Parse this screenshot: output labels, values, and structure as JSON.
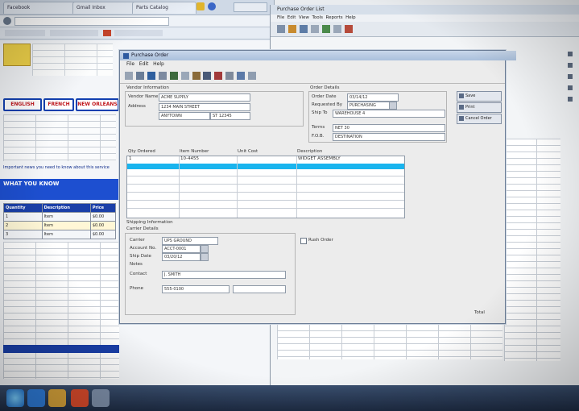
{
  "browser": {
    "tabs": [
      "Facebook",
      "Gmail Inbox",
      "Parts Catalog"
    ],
    "nav": {
      "site_buttons": [
        "ENGLISH",
        "FRENCH",
        "NEW ORLEANS"
      ]
    },
    "notice": "Important news you need to know about this service",
    "section_title": "WHAT YOU KNOW",
    "table": {
      "headers": [
        "Quantity",
        "Description",
        "Price"
      ],
      "rows": [
        [
          "1",
          "Item",
          "$0.00"
        ],
        [
          "2",
          "Item",
          "$0.00"
        ],
        [
          "3",
          "Item",
          "$0.00"
        ]
      ]
    }
  },
  "right_window": {
    "title": "Purchase Order List",
    "menu": [
      "File",
      "Edit",
      "View",
      "Tools",
      "Reports",
      "Help"
    ]
  },
  "dialog": {
    "title": "Purchase Order",
    "menu": [
      "File",
      "Edit",
      "Help"
    ],
    "vendor_section": "Vendor Information",
    "order_section": "Order Details",
    "vendor": {
      "label_name": "Vendor Name",
      "label_address": "Address",
      "name_value": "ACME SUPPLY",
      "address_line1": "1234 MAIN STREET",
      "address_line2": "ANYTOWN",
      "address_state": "ST 12345"
    },
    "order": {
      "label_date": "Order Date",
      "label_req": "Requested By",
      "label_ship": "Ship To",
      "label_terms": "Terms",
      "label_fob": "F.O.B.",
      "date_value": "03/14/12",
      "req_value": "PURCHASING",
      "ship_value": "WAREHOUSE 4",
      "terms_value": "NET 30",
      "fob_value": "DESTINATION"
    },
    "side_buttons": [
      "Save",
      "Print",
      "Cancel Order"
    ],
    "lines": {
      "columns": [
        "Qty Ordered",
        "Item Number",
        "Unit Cost",
        "Description"
      ],
      "rows": [
        [
          "1",
          "10-4455",
          "",
          "WIDGET ASSEMBLY"
        ],
        [
          "",
          "",
          "",
          ""
        ],
        [
          "",
          "",
          "",
          ""
        ],
        [
          "",
          "",
          "",
          ""
        ],
        [
          "",
          "",
          "",
          ""
        ]
      ]
    },
    "bottom": {
      "section": "Shipping Information",
      "sub": "Carrier Details",
      "label_carrier": "Carrier",
      "label_account": "Account No.",
      "label_ship_date": "Ship Date",
      "label_notes": "Notes",
      "label_contact": "Contact",
      "label_phone": "Phone",
      "carrier_value": "UPS GROUND",
      "account_value": "ACCT-0001",
      "ship_date_value": "03/20/12",
      "contact_value": "J. SMITH",
      "phone_value": "555-0100",
      "checkbox_label": "Rush Order",
      "footer_text": "Total"
    }
  },
  "colors": {
    "dialog_title": "#aac0dc",
    "selection": "#19b4ee",
    "site_blue": "#1d4fd0",
    "taskbar": "#2a3b58"
  }
}
